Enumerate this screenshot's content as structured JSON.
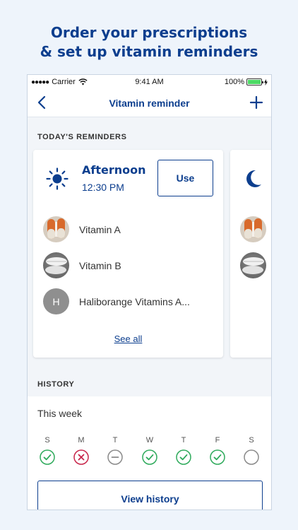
{
  "promo": {
    "line1": "Order your prescriptions",
    "line2": "& set up vitamin reminders"
  },
  "status_bar": {
    "carrier": "Carrier",
    "time": "9:41 AM",
    "battery": "100%"
  },
  "nav": {
    "title": "Vitamin reminder"
  },
  "today": {
    "section_label": "TODAY'S REMINDERS",
    "card": {
      "slot_name": "Afternoon",
      "slot_time": "12:30 PM",
      "use_label": "Use",
      "meds": [
        {
          "name": "Vitamin A",
          "image": "capsule-pills-image"
        },
        {
          "name": "Vitamin B",
          "image": "tablet-pills-image"
        },
        {
          "name": "Haliborange Vitamins A...",
          "initial": "H"
        }
      ],
      "see_all_label": "See all"
    },
    "next_card_icon": "moon-icon"
  },
  "history": {
    "section_label": "HISTORY",
    "period": "This week",
    "days": [
      {
        "letter": "S",
        "status": "taken"
      },
      {
        "letter": "M",
        "status": "missed"
      },
      {
        "letter": "T",
        "status": "skipped"
      },
      {
        "letter": "W",
        "status": "taken"
      },
      {
        "letter": "T",
        "status": "taken"
      },
      {
        "letter": "F",
        "status": "taken"
      },
      {
        "letter": "S",
        "status": "pending"
      }
    ],
    "view_history_label": "View history"
  },
  "colors": {
    "brand": "#0c3e8e",
    "taken": "#2eaa5b",
    "missed": "#c8254a",
    "neutral": "#8a8a8a"
  }
}
